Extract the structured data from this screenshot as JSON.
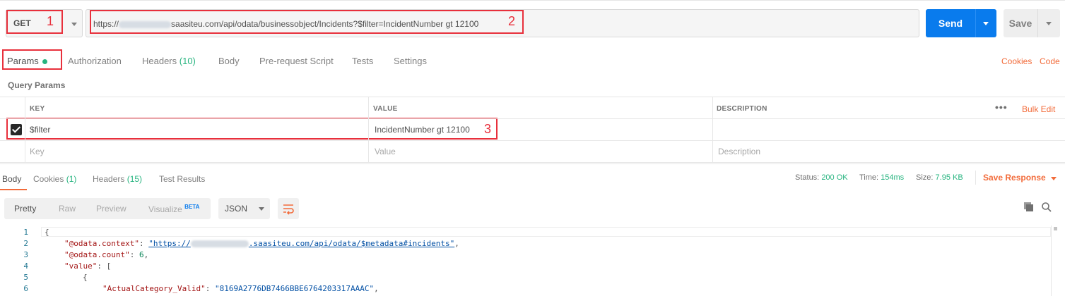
{
  "request": {
    "method": "GET",
    "url_prefix": "https://",
    "url_suffix": "saasiteu.com/api/odata/businessobject/Incidents?$filter=IncidentNumber gt 12100",
    "send_label": "Send",
    "save_label": "Save"
  },
  "annotations": {
    "method": "1",
    "url": "2",
    "param": "3"
  },
  "request_tabs": {
    "params": "Params",
    "authorization": "Authorization",
    "headers": "Headers",
    "headers_count": "(10)",
    "body": "Body",
    "prerequest": "Pre-request Script",
    "tests": "Tests",
    "settings": "Settings",
    "cookies": "Cookies",
    "code": "Code"
  },
  "query_params": {
    "title": "Query Params",
    "columns": {
      "key": "KEY",
      "value": "VALUE",
      "description": "DESCRIPTION"
    },
    "more": "•••",
    "bulk_edit": "Bulk Edit",
    "rows": [
      {
        "key": "$filter",
        "value": "IncidentNumber gt 12100",
        "checked": true
      }
    ],
    "placeholders": {
      "key": "Key",
      "value": "Value",
      "description": "Description"
    }
  },
  "response_tabs": {
    "body": "Body",
    "cookies": "Cookies",
    "cookies_count": "(1)",
    "headers": "Headers",
    "headers_count": "(15)",
    "test_results": "Test Results"
  },
  "response_status": {
    "status_label": "Status:",
    "status_value": "200 OK",
    "time_label": "Time:",
    "time_value": "154ms",
    "size_label": "Size:",
    "size_value": "7.95 KB",
    "save_response": "Save Response"
  },
  "view_toolbar": {
    "pretty": "Pretty",
    "raw": "Raw",
    "preview": "Preview",
    "visualize": "Visualize",
    "beta": "BETA",
    "format": "JSON"
  },
  "code": {
    "line_numbers": [
      "1",
      "2",
      "3",
      "4",
      "5",
      "6"
    ],
    "open_brace": "{",
    "context_key": "\"@odata.context\"",
    "context_prefix": "\"https://",
    "context_suffix": ".saasiteu.com/api/odata/$metadata#incidents\"",
    "count_key": "\"@odata.count\"",
    "count_value": "6",
    "value_key": "\"value\"",
    "open_bracket": "[",
    "inner_brace": "{",
    "category_key": "\"ActualCategory_Valid\"",
    "category_value": "\"8169A2776DB7466BBE6764203317AAAC\""
  },
  "colors": {
    "accent": "#f26b3a",
    "send": "#097bed",
    "success": "#26b47f",
    "annotation": "#e8303c"
  },
  "icons": [
    "chevron-down-icon",
    "wrap-lines-icon",
    "copy-icon",
    "search-icon",
    "checkbox-checked-icon",
    "status-dot-icon"
  ]
}
